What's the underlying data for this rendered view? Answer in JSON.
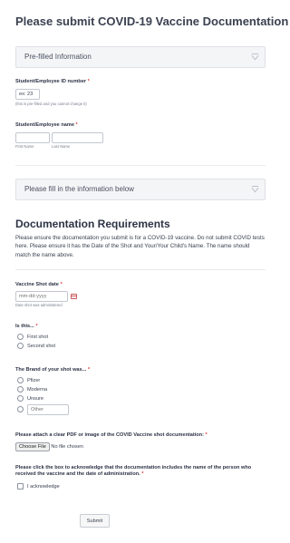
{
  "title": "Please submit COVID-19 Vaccine Documentation",
  "section1": {
    "label": "Pre-filled Information"
  },
  "id_field": {
    "label": "Student/Employee ID number",
    "required": "*",
    "value": "ex: 23",
    "note": "(this is pre-filled and you cannot change it)"
  },
  "name_field": {
    "label": "Student/Employee name",
    "required": "*",
    "first_sub": "First Name",
    "last_sub": "Last Name"
  },
  "section2": {
    "label": "Please fill in the information below"
  },
  "requirements": {
    "heading": "Documentation Requirements",
    "text": "Please ensure the documentation you submit is for a COVID-19 vaccine. Do not submit COVID tests here. Please ensure it has the Date of the Shot and Your/Your Child's Name. The name should match the name above."
  },
  "shot_date": {
    "label": "Vaccine Shot date",
    "required": "*",
    "placeholder": "mm-dd-yyyy",
    "sub": "Date shot was administered"
  },
  "is_this": {
    "label": "Is this...",
    "required": "*",
    "options": [
      "First shot",
      "Second shot"
    ]
  },
  "brand": {
    "label": "The Brand of your shot was...",
    "required": "*",
    "options": [
      "Pfizer",
      "Moderna",
      "Unsure"
    ],
    "other_placeholder": "Other"
  },
  "upload": {
    "label": "Please attach a clear PDF or image of the COVID Vaccine shot documentation:",
    "required": "*",
    "button": "Choose File",
    "status": "No file chosen"
  },
  "acknowledge": {
    "label": "Please click the box to acknowledge that the documentation includes the name of the person who received the vaccine and the date of administration.",
    "required": "*",
    "option": "I acknowledge"
  },
  "submit_label": "Submit"
}
